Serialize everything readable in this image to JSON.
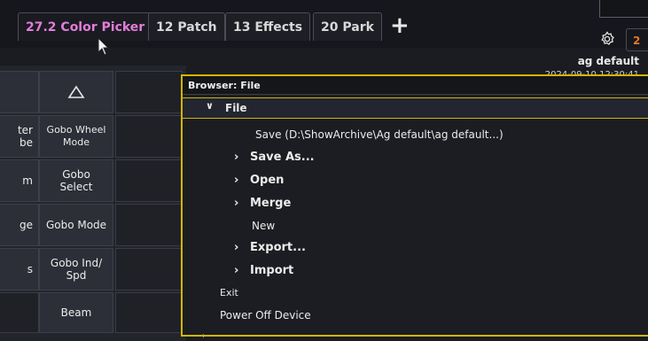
{
  "tabs": [
    {
      "label": "27.2 Color Picker",
      "active": true
    },
    {
      "label": "12 Patch",
      "active": false
    },
    {
      "label": "13 Effects",
      "active": false
    },
    {
      "label": "20 Park",
      "active": false
    }
  ],
  "add_tab_label": "+",
  "edge_tab_label": "2",
  "header": {
    "user": "ag default",
    "datetime": "2024-09-10 12:30:41"
  },
  "left_panel": {
    "up_arrow_icon": "triangle-up-icon",
    "partial_labels": [
      "ter\nbe",
      "m",
      "ge",
      "s"
    ],
    "buttons": [
      {
        "label": "Gobo Wheel\nMode"
      },
      {
        "label": "Gobo\nSelect"
      },
      {
        "label": "Gobo Mode"
      },
      {
        "label": "Gobo Ind/\nSpd"
      },
      {
        "label": "Beam"
      }
    ]
  },
  "browser": {
    "title": "Browser: File",
    "root": "File",
    "items": [
      {
        "label": "Save (D:\\ShowArchive\\Ag default\\ag default...)",
        "has_children": false,
        "level": 2
      },
      {
        "label": "Save As...",
        "has_children": true,
        "level": 1
      },
      {
        "label": "Open",
        "has_children": true,
        "level": 1
      },
      {
        "label": "Merge",
        "has_children": true,
        "level": 1
      },
      {
        "label": "New",
        "has_children": false,
        "level": 1
      },
      {
        "label": "Export...",
        "has_children": true,
        "level": 1
      },
      {
        "label": "Import",
        "has_children": true,
        "level": 1
      },
      {
        "label": "Exit",
        "has_children": false,
        "level": 0
      },
      {
        "label": "Power Off Device",
        "has_children": false,
        "level": 0
      }
    ]
  },
  "colors": {
    "accent_tab": "#e27dd8",
    "window_border": "#d4b400",
    "edge_tab": "#e07a2a"
  }
}
